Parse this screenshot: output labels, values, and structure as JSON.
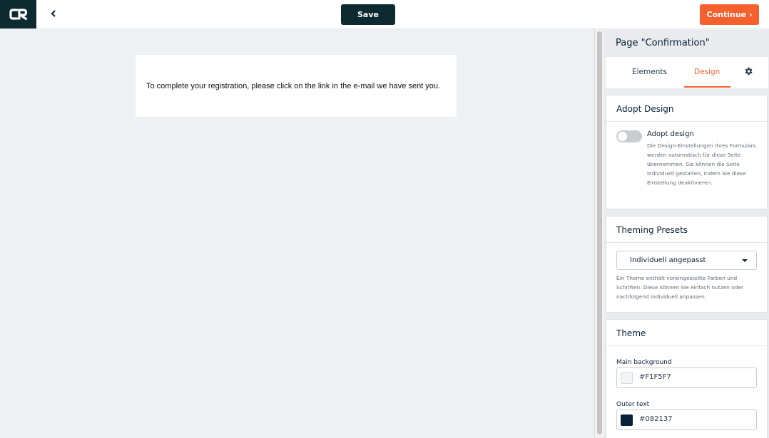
{
  "topbar": {
    "save_label": "Save",
    "continue_label": "Continue ›",
    "brand_color": "#0c2a2f",
    "accent_color": "#f5602e"
  },
  "canvas": {
    "confirmation_text": "To complete your registration, please click on the link in the e-mail we have sent you."
  },
  "panel": {
    "title": "Page \"Confirmation\"",
    "tabs": [
      {
        "label": "Elements",
        "active": false
      },
      {
        "label": "Design",
        "active": true
      },
      {
        "label": "settings",
        "icon": "gear-icon"
      }
    ],
    "adopt_design": {
      "section_title": "Adopt Design",
      "toggle_label": "Adopt design",
      "toggle_on": false,
      "description": "Die Design-Einstellungen Ihres Formulars werden automatisch für diese Seite übernommen. Sie können die Seite individuell gestalten, indem Sie diese Einstellung deaktivieren."
    },
    "theming_presets": {
      "section_title": "Theming Presets",
      "selected": "Individuell angepasst",
      "description": "Ein Theme enthält voreingestellte Farben und Schriften. Diese können Sie einfach nutzen oder nachfolgend individuell anpassen."
    },
    "theme": {
      "section_title": "Theme",
      "main_background": {
        "label": "Main background",
        "value": "#F1F5F7"
      },
      "outer_text": {
        "label": "Outer text",
        "value": "#082137"
      }
    }
  }
}
